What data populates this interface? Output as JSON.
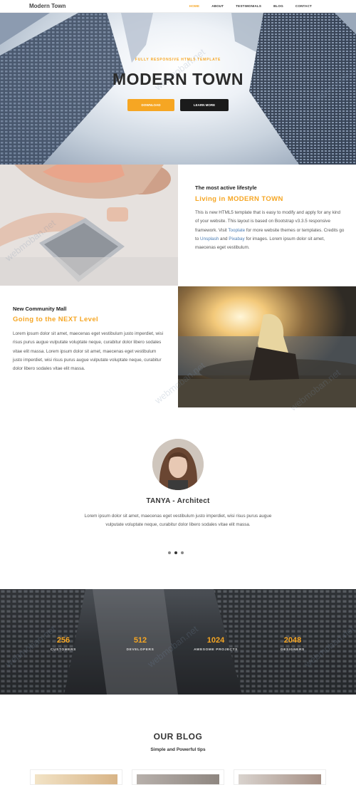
{
  "nav": {
    "brand": "Modern Town",
    "items": [
      {
        "label": "HOME",
        "active": true
      },
      {
        "label": "ABOUT",
        "active": false
      },
      {
        "label": "TESTIMONIALS",
        "active": false
      },
      {
        "label": "BLOG",
        "active": false
      },
      {
        "label": "CONTACT",
        "active": false
      }
    ]
  },
  "hero": {
    "subtitle": "FULLY RESPONSIVE HTML5 TEMPLATE",
    "title": "MODERN TOWN",
    "download_label": "DOWNLOAD",
    "learn_more_label": "LEARN MORE"
  },
  "feature1": {
    "kicker": "The most active lifestyle",
    "title": "Living in MODERN TOWN",
    "body_part1": "This is new HTML5 template that is easy to modify and apply for any kind of your website. This layout is based on Bootstrap v3.3.5 responsive framework. Visit ",
    "link1": "Tooplate",
    "body_part2": " for more website themes or templates. Credits go to ",
    "link2": "Unsplash",
    "body_part3": " and ",
    "link3": "Pixabay",
    "body_part4": " for images. Lorem ipsum dolor sit amet, maecenas eget vestibulum."
  },
  "feature2": {
    "kicker": "New Community Mall",
    "title": "Going to the NEXT Level",
    "body": "Lorem ipsum dolor sit amet, maecenas eget vestibulum justo imperdiet, wisi risus purus augue vulputate voluptate neque, curabitur dolor libero sodales vitae elit massa. Lorem ipsum dolor sit amet, maecenas eget vestibulum justo imperdiet, wisi risus purus augue vulputate voluptate neque, curabitur dolor libero sodales vitae elit massa."
  },
  "testimonial": {
    "name": "TANYA - Architect",
    "body": "Lorem ipsum dolor sit amet, maecenas eget vestibulum justo imperdiet, wisi risus purus augue vulputate voluptate neque, curabitur dolor libero sodales vitae elit massa.",
    "dots": 3,
    "active_dot": 2
  },
  "stats": [
    {
      "number": "256",
      "label": "CUSTOMERS"
    },
    {
      "number": "512",
      "label": "DEVELOPERS"
    },
    {
      "number": "1024",
      "label": "AWESOME PROJECTS"
    },
    {
      "number": "2048",
      "label": "DESIGNERS"
    }
  ],
  "blog": {
    "title": "OUR BLOG",
    "subtitle": "Simple and Powerful tips"
  },
  "watermark": "webmoban.net",
  "colors": {
    "accent": "#f6a623",
    "dark": "#1b1b1b",
    "link": "#4a7db5"
  }
}
